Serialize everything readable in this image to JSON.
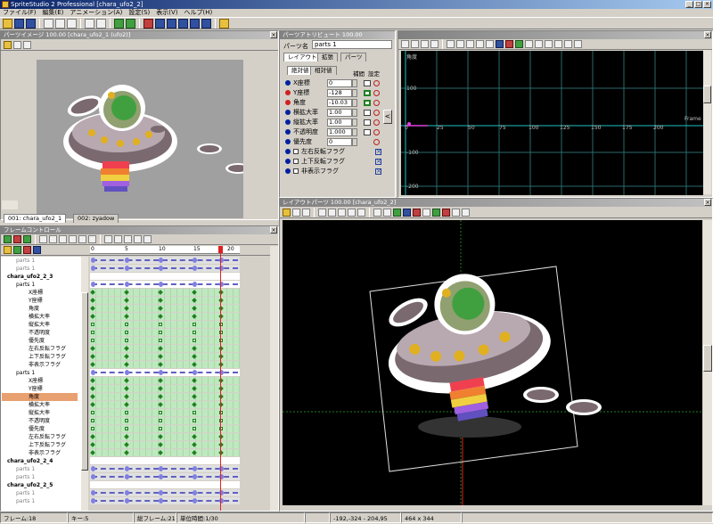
{
  "app": {
    "title": "SpriteStudio 2 Professional [chara_ufo2_2]"
  },
  "menu": [
    "ファイル(F)",
    "編集(E)",
    "アニメーション(A)",
    "設定(S)",
    "表示(V)",
    "ヘルプ(H)"
  ],
  "parts_view": {
    "title": "パーツイメージ 100.00 [chara_ufo2_1 (ufo2)]",
    "tabs": [
      "001: chara_ufo2_1",
      "002: zyadow"
    ]
  },
  "attributes": {
    "title": "パーツアトリビュート 100.00",
    "part_name_label": "パーツ名",
    "part_name_value": "parts 1",
    "tabs": [
      "レイアウト",
      "拡張",
      "パーツ"
    ],
    "subtabs": [
      "絶対値",
      "相対値"
    ],
    "col_interp": "補間",
    "col_key": "設定",
    "rows": [
      {
        "label": "X座標",
        "value": "0"
      },
      {
        "label": "Y座標",
        "value": "-128"
      },
      {
        "label": "角度",
        "value": "-10.03"
      },
      {
        "label": "横拡大率",
        "value": "1.00"
      },
      {
        "label": "縦拡大率",
        "value": "1.00"
      },
      {
        "label": "不透明度",
        "value": "1.000"
      },
      {
        "label": "優先度",
        "value": "0"
      }
    ],
    "flags": [
      "左右反転フラグ",
      "上下反転フラグ",
      "非表示フラグ"
    ]
  },
  "graph": {
    "frame_label": "Frame",
    "y_ticks": [
      "100",
      "-100",
      "-200"
    ],
    "x_ticks": [
      "0",
      "25",
      "50",
      "75",
      "100",
      "125",
      "150",
      "175",
      "200"
    ],
    "top_label": "角度"
  },
  "layout_view": {
    "title": "レイアウトパーツ 100.00 [chara_ufo2_2]"
  },
  "frame_control": {
    "title": "フレームコントロール",
    "ruler": [
      "0",
      "5",
      "10",
      "15",
      "20"
    ],
    "tree": [
      {
        "label": "parts 1",
        "kind": "grey"
      },
      {
        "label": "parts 1",
        "kind": "grey"
      },
      {
        "label": "chara_ufo2_2_3",
        "kind": "hdr"
      },
      {
        "label": "parts 1",
        "kind": "part"
      },
      {
        "label": "X座標",
        "kind": "attr"
      },
      {
        "label": "Y座標",
        "kind": "attr"
      },
      {
        "label": "角度",
        "kind": "attr"
      },
      {
        "label": "横拡大率",
        "kind": "attr"
      },
      {
        "label": "縦拡大率",
        "kind": "attr"
      },
      {
        "label": "不透明度",
        "kind": "attr"
      },
      {
        "label": "優先度",
        "kind": "attr"
      },
      {
        "label": "左右反転フラグ",
        "kind": "attr"
      },
      {
        "label": "上下反転フラグ",
        "kind": "attr"
      },
      {
        "label": "非表示フラグ",
        "kind": "attr"
      },
      {
        "label": "parts 1",
        "kind": "part"
      },
      {
        "label": "X座標",
        "kind": "attr"
      },
      {
        "label": "Y座標",
        "kind": "attr"
      },
      {
        "label": "角度",
        "kind": "sel"
      },
      {
        "label": "横拡大率",
        "kind": "attr"
      },
      {
        "label": "縦拡大率",
        "kind": "attr"
      },
      {
        "label": "不透明度",
        "kind": "attr"
      },
      {
        "label": "優先度",
        "kind": "attr"
      },
      {
        "label": "左右反転フラグ",
        "kind": "attr"
      },
      {
        "label": "上下反転フラグ",
        "kind": "attr"
      },
      {
        "label": "非表示フラグ",
        "kind": "attr"
      },
      {
        "label": "chara_ufo2_2_4",
        "kind": "hdr"
      },
      {
        "label": "parts 1",
        "kind": "grey"
      },
      {
        "label": "parts 1",
        "kind": "grey"
      },
      {
        "label": "chara_ufo2_2_5",
        "kind": "hdr"
      },
      {
        "label": "parts 1",
        "kind": "grey"
      },
      {
        "label": "parts 1",
        "kind": "grey"
      }
    ]
  },
  "status": {
    "frame": "フレーム:18",
    "key": "キー:5",
    "total": "総フレーム:21",
    "unit": "単位時間:1/30",
    "coords": "-192,-324 - 204,95",
    "size": "464 x 344"
  },
  "colors": {
    "accent": "#0a246a",
    "keyframe": "#208020",
    "blue_key": "#8080e0",
    "cursor": "#e02020"
  }
}
